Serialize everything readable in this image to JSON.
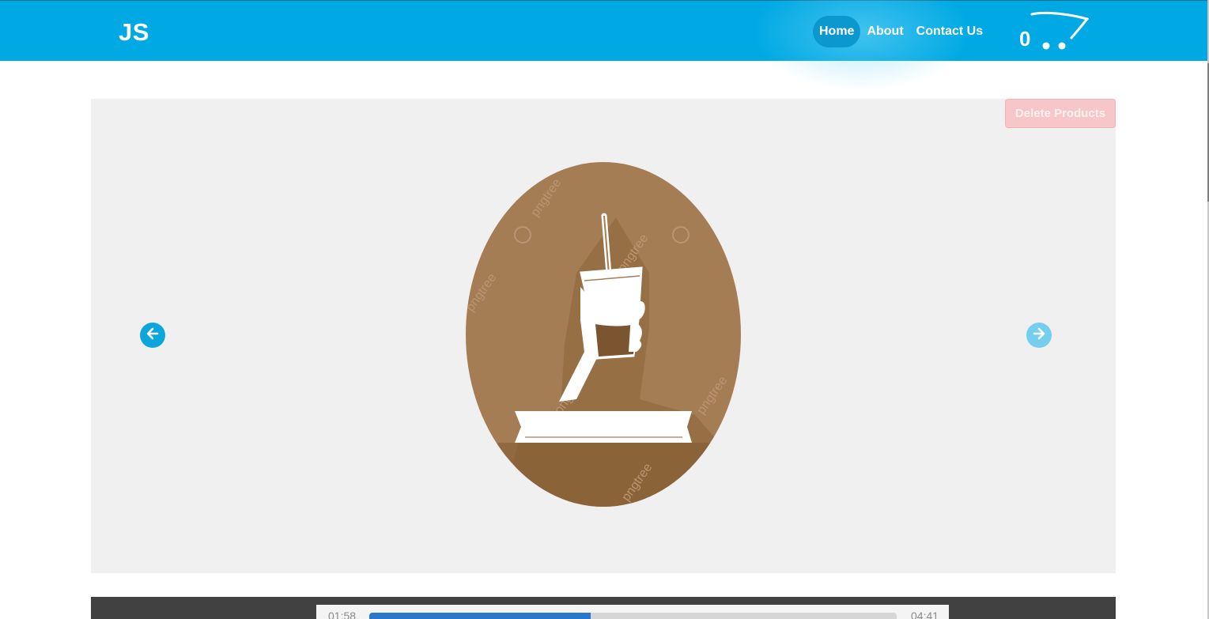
{
  "header": {
    "logo": "JS",
    "nav": [
      {
        "label": "Home",
        "active": true
      },
      {
        "label": "About",
        "active": false
      },
      {
        "label": "Contact Us",
        "active": false
      }
    ],
    "cart_count": "0",
    "brand_color": "#00a9e3"
  },
  "slider": {
    "delete_button_label": "Delete Products",
    "prev_icon": "arrow-left-icon",
    "next_icon": "arrow-right-icon",
    "image_subject": "coffee-cup-icon",
    "watermark": "pngtree"
  },
  "player": {
    "current_time": "01:58",
    "total_time": "04:41",
    "progress": 0.42,
    "accent_color": "#2a78cc"
  }
}
